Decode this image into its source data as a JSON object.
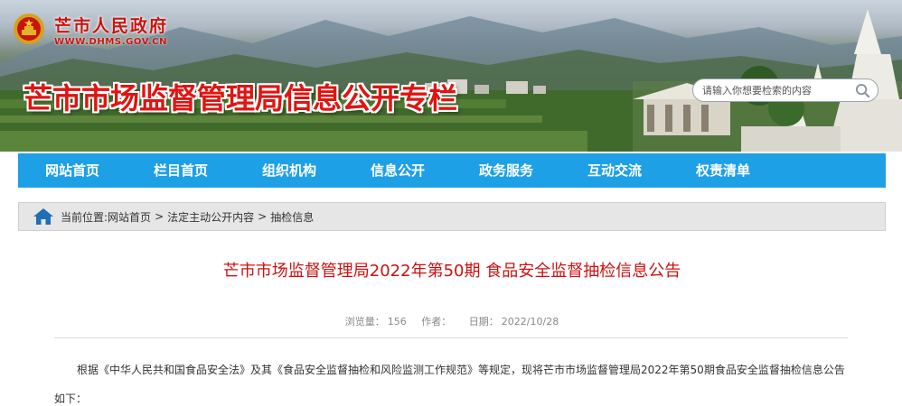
{
  "header": {
    "gov_name": "芒市人民政府",
    "gov_url": "WWW.DHMS.GOV.CN",
    "banner_title": "芒市市场监督管理局信息公开专栏",
    "search_placeholder": "请输入你想要检索的内容"
  },
  "nav": {
    "items": [
      {
        "label": "网站首页"
      },
      {
        "label": "栏目首页"
      },
      {
        "label": "组织机构"
      },
      {
        "label": "信息公开"
      },
      {
        "label": "政务服务"
      },
      {
        "label": "互动交流"
      },
      {
        "label": "权责清单"
      }
    ]
  },
  "breadcrumb": {
    "prefix": "当前位置:",
    "items": [
      "网站首页",
      "法定主动公开内容",
      "抽检信息"
    ],
    "separator": ">"
  },
  "article": {
    "title": "芒市市场监督管理局2022年第50期 食品安全监督抽检信息公告",
    "views_label": "浏览量：",
    "views": "156",
    "author_label": "作者：",
    "author": "",
    "date_label": "日期：",
    "date": "2022/10/28",
    "paragraph": "根据《中华人民共和国食品安全法》及其《食品安全监督抽检和风险监测工作规范》等规定，现将芒市市场监督管理局2022年第50期食品安全监督抽检信息公告如下："
  },
  "colors": {
    "nav_bg": "#1ea0e6",
    "title_red": "#d01010",
    "banner_red": "#e01412"
  }
}
